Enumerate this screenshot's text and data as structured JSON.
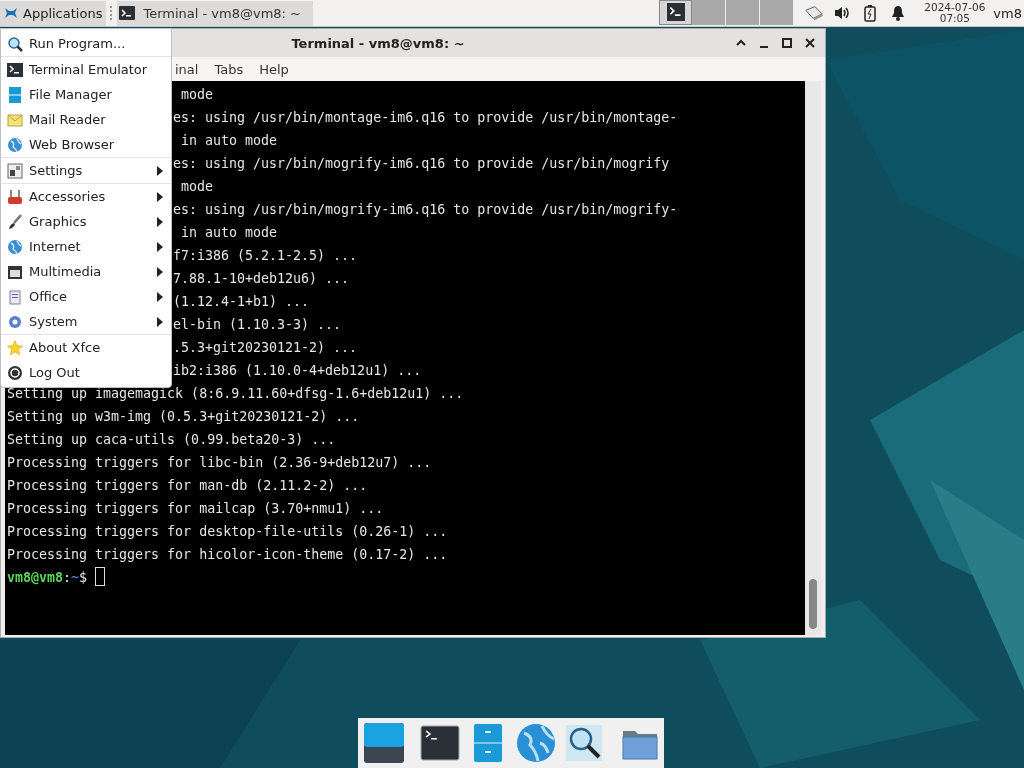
{
  "top_panel": {
    "applications_label": "Applications",
    "tasks": [
      {
        "title": "Terminal - vm8@vm8: ~",
        "selected": true
      }
    ],
    "workspaces": [
      {
        "selected": true
      },
      {
        "selected": false
      },
      {
        "selected": false
      },
      {
        "selected": false
      }
    ],
    "clock": {
      "date": "2024-07-06",
      "time": "07:05"
    },
    "user": "vm8"
  },
  "window": {
    "title": "Terminal - vm8@vm8: ~",
    "menu": [
      "inal",
      "Tabs",
      "Help"
    ],
    "lines": [
      {
        "kind": "partial",
        "text": " mode"
      },
      {
        "kind": "partial",
        "text": "es: using /usr/bin/montage-im6.q16 to provide /usr/bin/montage-"
      },
      {
        "kind": "partial",
        "text": " in auto mode"
      },
      {
        "kind": "partial",
        "text": "es: using /usr/bin/mogrify-im6.q16 to provide /usr/bin/mogrify"
      },
      {
        "kind": "partial",
        "text": " mode"
      },
      {
        "kind": "partial",
        "text": "es: using /usr/bin/mogrify-im6.q16 to provide /usr/bin/mogrify-"
      },
      {
        "kind": "partial",
        "text": " in auto mode"
      },
      {
        "kind": "partial",
        "text": "f7:i386 (5.2.1-2.5) ..."
      },
      {
        "kind": "partial",
        "text": "7.88.1-10+deb12u6) ..."
      },
      {
        "kind": "partial",
        "text": "(1.12.4-1+b1) ..."
      },
      {
        "kind": "partial",
        "text": "el-bin (1.10.3-3) ..."
      },
      {
        "kind": "partial",
        "text": ".5.3+git20230121-2) ..."
      },
      {
        "kind": "partial",
        "text": "ib2:i386 (1.10.0-4+deb12u1) ..."
      },
      {
        "kind": "full",
        "text": "Setting up imagemagick (8:6.9.11.60+dfsg-1.6+deb12u1) ..."
      },
      {
        "kind": "full",
        "text": "Setting up w3m-img (0.5.3+git20230121-2) ..."
      },
      {
        "kind": "full",
        "text": "Setting up caca-utils (0.99.beta20-3) ..."
      },
      {
        "kind": "full",
        "text": "Processing triggers for libc-bin (2.36-9+deb12u7) ..."
      },
      {
        "kind": "full",
        "text": "Processing triggers for man-db (2.11.2-2) ..."
      },
      {
        "kind": "full",
        "text": "Processing triggers for mailcap (3.70+nmu1) ..."
      },
      {
        "kind": "full",
        "text": "Processing triggers for desktop-file-utils (0.26-1) ..."
      },
      {
        "kind": "full",
        "text": "Processing triggers for hicolor-icon-theme (0.17-2) ..."
      }
    ],
    "prompt": {
      "user": "vm8@vm8",
      "separator": ":",
      "path": "~",
      "symbol": "$"
    }
  },
  "app_menu": {
    "groups": [
      [
        {
          "label": "Run Program...",
          "submenu": false
        }
      ],
      [
        {
          "label": "Terminal Emulator",
          "submenu": false
        },
        {
          "label": "File Manager",
          "submenu": false
        },
        {
          "label": "Mail Reader",
          "submenu": false
        },
        {
          "label": "Web Browser",
          "submenu": false
        }
      ],
      [
        {
          "label": "Settings",
          "submenu": true
        }
      ],
      [
        {
          "label": "Accessories",
          "submenu": true
        },
        {
          "label": "Graphics",
          "submenu": true
        },
        {
          "label": "Internet",
          "submenu": true
        },
        {
          "label": "Multimedia",
          "submenu": true
        },
        {
          "label": "Office",
          "submenu": true
        },
        {
          "label": "System",
          "submenu": true
        }
      ],
      [
        {
          "label": "About Xfce",
          "submenu": false
        },
        {
          "label": "Log Out",
          "submenu": false
        }
      ]
    ]
  }
}
